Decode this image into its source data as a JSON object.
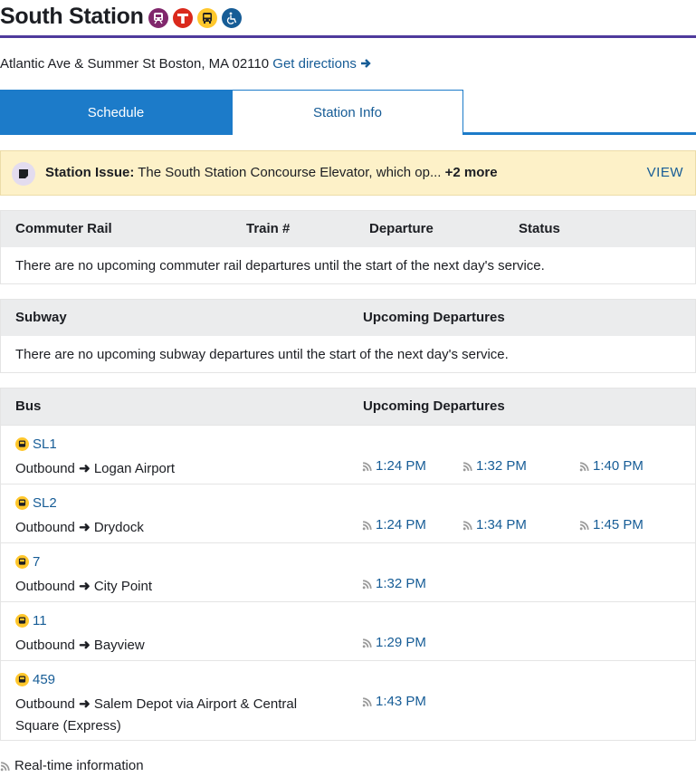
{
  "station": {
    "name": "South Station",
    "address": "Atlantic Ave & Summer St Boston, MA 02110",
    "directions_label": "Get directions"
  },
  "tabs": [
    {
      "label": "Schedule",
      "active": true
    },
    {
      "label": "Station Info",
      "active": false
    }
  ],
  "alert": {
    "label": "Station Issue:",
    "message": "The South Station Concourse Elevator, which op...",
    "more": "+2 more",
    "action": "VIEW"
  },
  "commuter_rail": {
    "headers": [
      "Commuter Rail",
      "Train #",
      "Departure",
      "Status"
    ],
    "message": "There are no upcoming commuter rail departures until the start of the next day's service."
  },
  "subway": {
    "headers": [
      "Subway",
      "Upcoming Departures"
    ],
    "message": "There are no upcoming subway departures until the start of the next day's service."
  },
  "bus": {
    "headers": [
      "Bus",
      "Upcoming Departures"
    ],
    "routes": [
      {
        "route": "SL1",
        "direction": "Outbound",
        "destination": "Logan Airport",
        "times": [
          "1:24 PM",
          "1:32 PM",
          "1:40 PM"
        ]
      },
      {
        "route": "SL2",
        "direction": "Outbound",
        "destination": "Drydock",
        "times": [
          "1:24 PM",
          "1:34 PM",
          "1:45 PM"
        ]
      },
      {
        "route": "7",
        "direction": "Outbound",
        "destination": "City Point",
        "times": [
          "1:32 PM"
        ]
      },
      {
        "route": "11",
        "direction": "Outbound",
        "destination": "Bayview",
        "times": [
          "1:29 PM"
        ]
      },
      {
        "route": "459",
        "direction": "Outbound",
        "destination": "Salem Depot via Airport & Central",
        "destination_line2": "Square (Express)",
        "times": [
          "1:43 PM"
        ]
      }
    ]
  },
  "footer": {
    "label": "Real-time information"
  },
  "colors": {
    "brand_purple": "#4f3a9c",
    "link_blue": "#165c96",
    "tab_blue": "#1c7bc9",
    "alert_bg": "#fdf1c8",
    "bus_yellow": "#ffc72c"
  }
}
